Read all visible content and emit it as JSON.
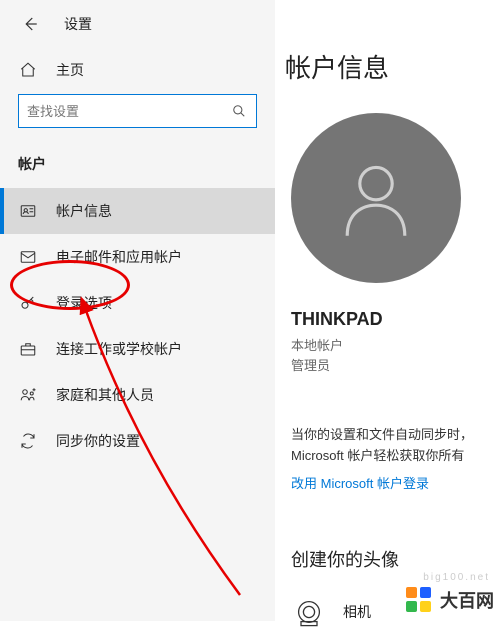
{
  "header": {
    "settings_label": "设置"
  },
  "home": {
    "label": "主页"
  },
  "search": {
    "placeholder": "查找设置"
  },
  "sidebar": {
    "section_title": "帐户",
    "items": [
      {
        "label": "帐户信息",
        "icon": "user-badge-icon",
        "active": true
      },
      {
        "label": "电子邮件和应用帐户",
        "icon": "mail-icon",
        "active": false
      },
      {
        "label": "登录选项",
        "icon": "key-icon",
        "active": false
      },
      {
        "label": "连接工作或学校帐户",
        "icon": "briefcase-icon",
        "active": false
      },
      {
        "label": "家庭和其他人员",
        "icon": "family-icon",
        "active": false
      },
      {
        "label": "同步你的设置",
        "icon": "sync-icon",
        "active": false
      }
    ]
  },
  "main": {
    "title": "帐户信息",
    "user_name": "THINKPAD",
    "account_type": "本地帐户",
    "role": "管理员",
    "sync_line1": "当你的设置和文件自动同步时，",
    "sync_line2": "Microsoft 帐户轻松获取你所有",
    "login_link": "改用 Microsoft 帐户登录",
    "avatar_heading": "创建你的头像",
    "camera_label": "相机"
  },
  "watermark": {
    "text": "大百网",
    "url": "big100.net"
  }
}
